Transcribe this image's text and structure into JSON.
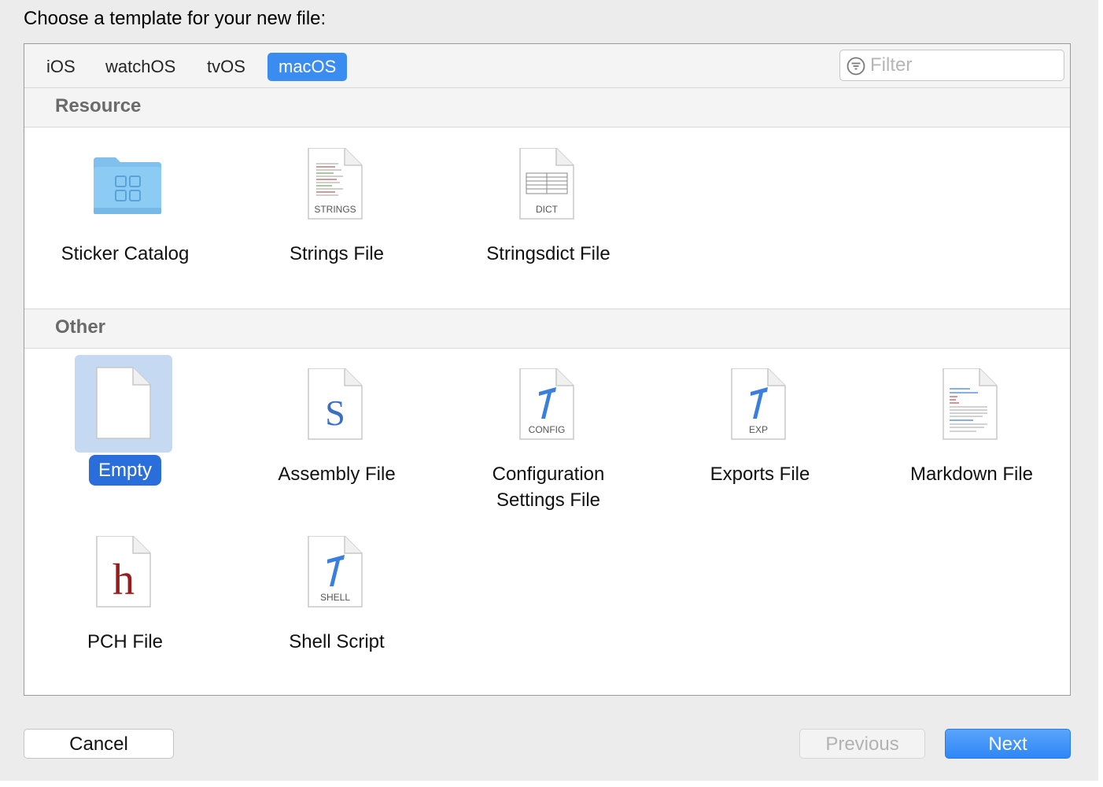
{
  "dialog": {
    "prompt": "Choose a template for your new file:"
  },
  "platform_tabs": [
    {
      "label": "iOS",
      "active": false
    },
    {
      "label": "watchOS",
      "active": false
    },
    {
      "label": "tvOS",
      "active": false
    },
    {
      "label": "macOS",
      "active": true
    }
  ],
  "filter": {
    "placeholder": "Filter",
    "value": ""
  },
  "sections": [
    {
      "title": "Resource",
      "items": [
        {
          "label": "Sticker Catalog",
          "icon": "folder-icon",
          "selected": false
        },
        {
          "label": "Strings File",
          "icon": "strings-file-icon",
          "badge": "STRINGS",
          "selected": false
        },
        {
          "label": "Stringsdict File",
          "icon": "stringsdict-file-icon",
          "badge": "DICT",
          "selected": false
        }
      ]
    },
    {
      "title": "Other",
      "items": [
        {
          "label": "Empty",
          "icon": "empty-file-icon",
          "selected": true
        },
        {
          "label": "Assembly File",
          "icon": "assembly-file-icon",
          "glyph": "S",
          "selected": false
        },
        {
          "label_line1": "Configuration",
          "label_line2": "Settings File",
          "icon": "config-file-icon",
          "badge": "CONFIG",
          "selected": false
        },
        {
          "label": "Exports File",
          "icon": "exports-file-icon",
          "badge": "EXP",
          "selected": false
        },
        {
          "label": "Markdown File",
          "icon": "markdown-file-icon",
          "selected": false
        },
        {
          "label": "PCH File",
          "icon": "pch-file-icon",
          "glyph": "h",
          "selected": false
        },
        {
          "label": "Shell Script",
          "icon": "shell-script-icon",
          "badge": "SHELL",
          "selected": false
        }
      ]
    }
  ],
  "buttons": {
    "cancel": "Cancel",
    "previous": "Previous",
    "next": "Next"
  },
  "colors": {
    "accent": "#3b8cf0",
    "selection_bg": "#c5d9f2",
    "selection_label": "#2a6edb",
    "hammer": "#3a7fdc",
    "pch_glyph": "#9b1b1b"
  }
}
